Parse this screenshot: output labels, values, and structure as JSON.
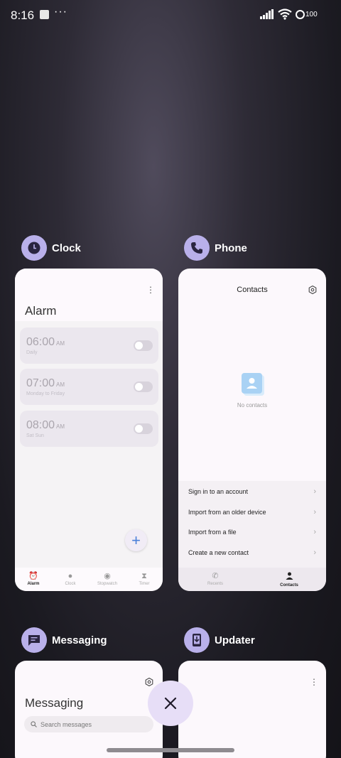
{
  "status_bar": {
    "time": "8:16",
    "extra": "···",
    "battery": "100"
  },
  "apps": [
    {
      "name": "Clock",
      "screen": {
        "title": "Alarm",
        "alarms": [
          {
            "time": "06:00",
            "ampm": "AM",
            "repeat": "Daily",
            "enabled": false
          },
          {
            "time": "07:00",
            "ampm": "AM",
            "repeat": "Monday to Friday",
            "enabled": false
          },
          {
            "time": "08:00",
            "ampm": "AM",
            "repeat": "Sat Sun",
            "enabled": false
          }
        ],
        "fab_label": "+",
        "nav": [
          {
            "label": "Alarm",
            "icon": "alarm-icon",
            "active": true
          },
          {
            "label": "Clock",
            "icon": "clock-icon",
            "active": false
          },
          {
            "label": "Stopwatch",
            "icon": "stopwatch-icon",
            "active": false
          },
          {
            "label": "Timer",
            "icon": "hourglass-icon",
            "active": false
          }
        ]
      }
    },
    {
      "name": "Phone",
      "screen": {
        "title": "Contacts",
        "empty_text": "No contacts",
        "options": [
          "Sign in to an account",
          "Import from an older device",
          "Import from a file",
          "Create a new contact"
        ],
        "nav": [
          {
            "label": "Recents",
            "icon": "phone-icon",
            "active": false
          },
          {
            "label": "Contacts",
            "icon": "person-icon",
            "active": true
          }
        ]
      }
    },
    {
      "name": "Messaging",
      "screen": {
        "title": "Messaging",
        "search_placeholder": "Search messages"
      }
    },
    {
      "name": "Updater",
      "screen": {}
    }
  ],
  "colors": {
    "app_icon_bg": "#b9b0ea",
    "close_button_bg": "#e7def7",
    "accent_blue": "#4a80d9"
  }
}
